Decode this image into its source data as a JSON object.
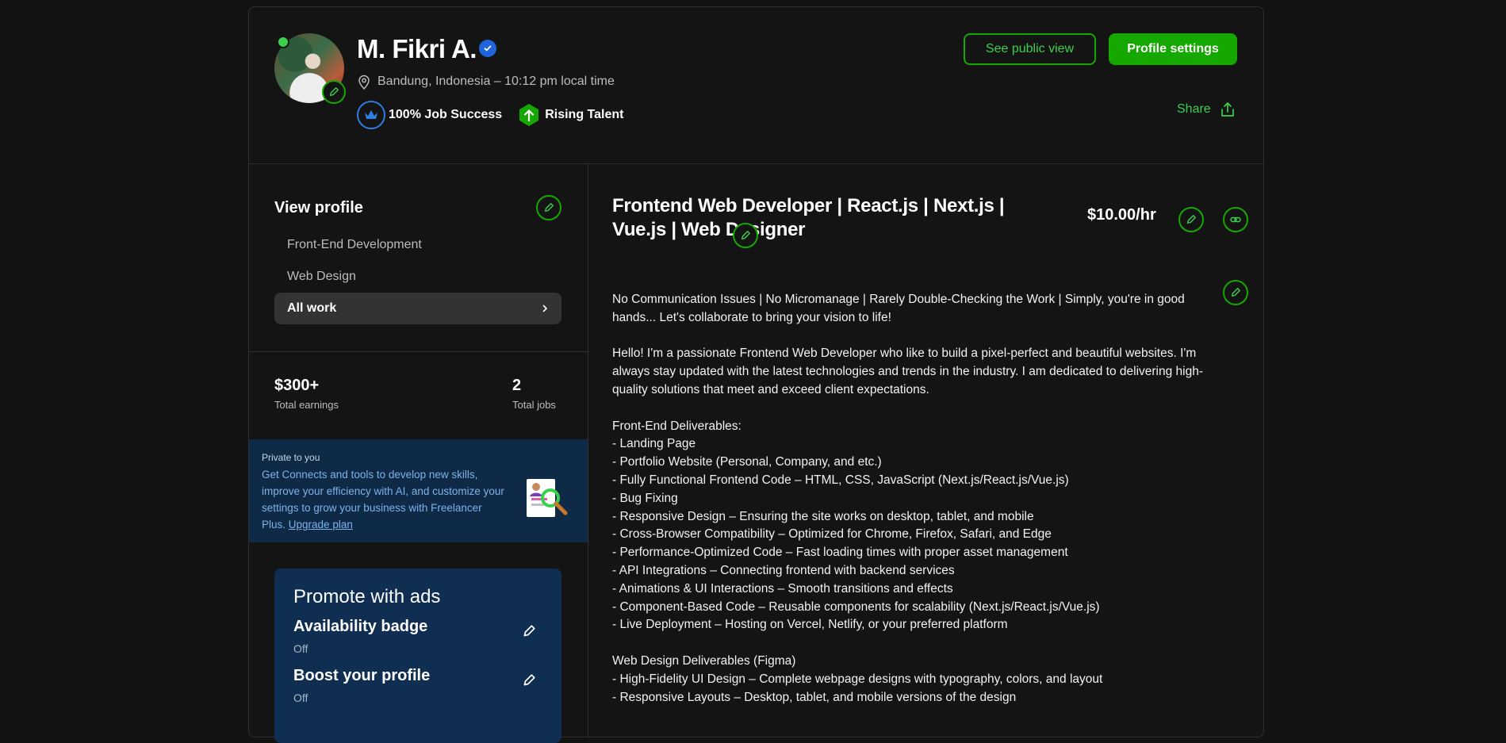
{
  "profile": {
    "name": "M. Fikri A.",
    "location": "Bandung, Indonesia – 10:12 pm local time",
    "job_success": "100% Job Success",
    "rising_talent": "Rising Talent"
  },
  "header_actions": {
    "public_view": "See public view",
    "profile_settings": "Profile settings",
    "share": "Share"
  },
  "sidebar": {
    "view_profile": "View profile",
    "specializations": [
      "Front-End Development",
      "Web Design"
    ],
    "all_work": "All work",
    "earnings_value": "$300+",
    "earnings_label": "Total earnings",
    "jobs_value": "2",
    "jobs_label": "Total jobs",
    "private_label": "Private to you",
    "private_text": "Get Connects and tools to develop new skills, improve your efficiency with AI, and customize your settings to grow your business with Freelancer Plus.",
    "upgrade_link": "Upgrade plan",
    "promote_title": "Promote with ads",
    "availability_title": "Availability badge",
    "availability_status": "Off",
    "boost_title": "Boost your profile",
    "boost_status": "Off"
  },
  "main": {
    "title": "Frontend Web Developer | React.js | Next.js | Vue.js | Web Designer",
    "rate": "$10.00/hr",
    "intro": "No Communication Issues | No Micromanage | Rarely Double-Checking the Work | Simply, you're in good hands... Let's collaborate to bring your vision to life!",
    "about": "Hello! I'm a passionate Frontend Web Developer who like to build a pixel-perfect and beautiful websites. I'm always stay updated with the latest technologies and trends in the industry. I am dedicated to delivering high-quality solutions that meet and exceed client expectations.",
    "fe_heading": "Front-End Deliverables:",
    "fe_items": [
      "- Landing Page",
      "- Portfolio Website (Personal, Company, and etc.)",
      "- Fully Functional Frontend Code – HTML, CSS, JavaScript (Next.js/React.js/Vue.js)",
      "- Bug Fixing",
      "- Responsive Design – Ensuring the site works on desktop, tablet, and mobile",
      "- Cross-Browser Compatibility – Optimized for Chrome, Firefox, Safari, and Edge",
      "- Performance-Optimized Code – Fast loading times with proper asset management",
      "- API Integrations – Connecting frontend with backend services",
      "- Animations & UI Interactions – Smooth transitions and effects",
      "- Component-Based Code – Reusable components for scalability (Next.js/React.js/Vue.js)",
      "- Live Deployment – Hosting on Vercel, Netlify, or your preferred platform"
    ],
    "wd_heading": "Web Design Deliverables (Figma)",
    "wd_items": [
      "- High-Fidelity UI Design – Complete webpage designs with typography, colors, and layout",
      "- Responsive Layouts – Desktop, tablet, and mobile versions of the design"
    ]
  },
  "colors": {
    "accent_green": "#14a800",
    "link_blue": "#7fb2e8",
    "private_bg": "#0e2a47"
  },
  "icons": [
    "pencil-icon",
    "verified-icon",
    "location-pin-icon",
    "crown-icon",
    "arrow-up-icon",
    "share-icon",
    "chevron-right-icon",
    "link-icon"
  ]
}
